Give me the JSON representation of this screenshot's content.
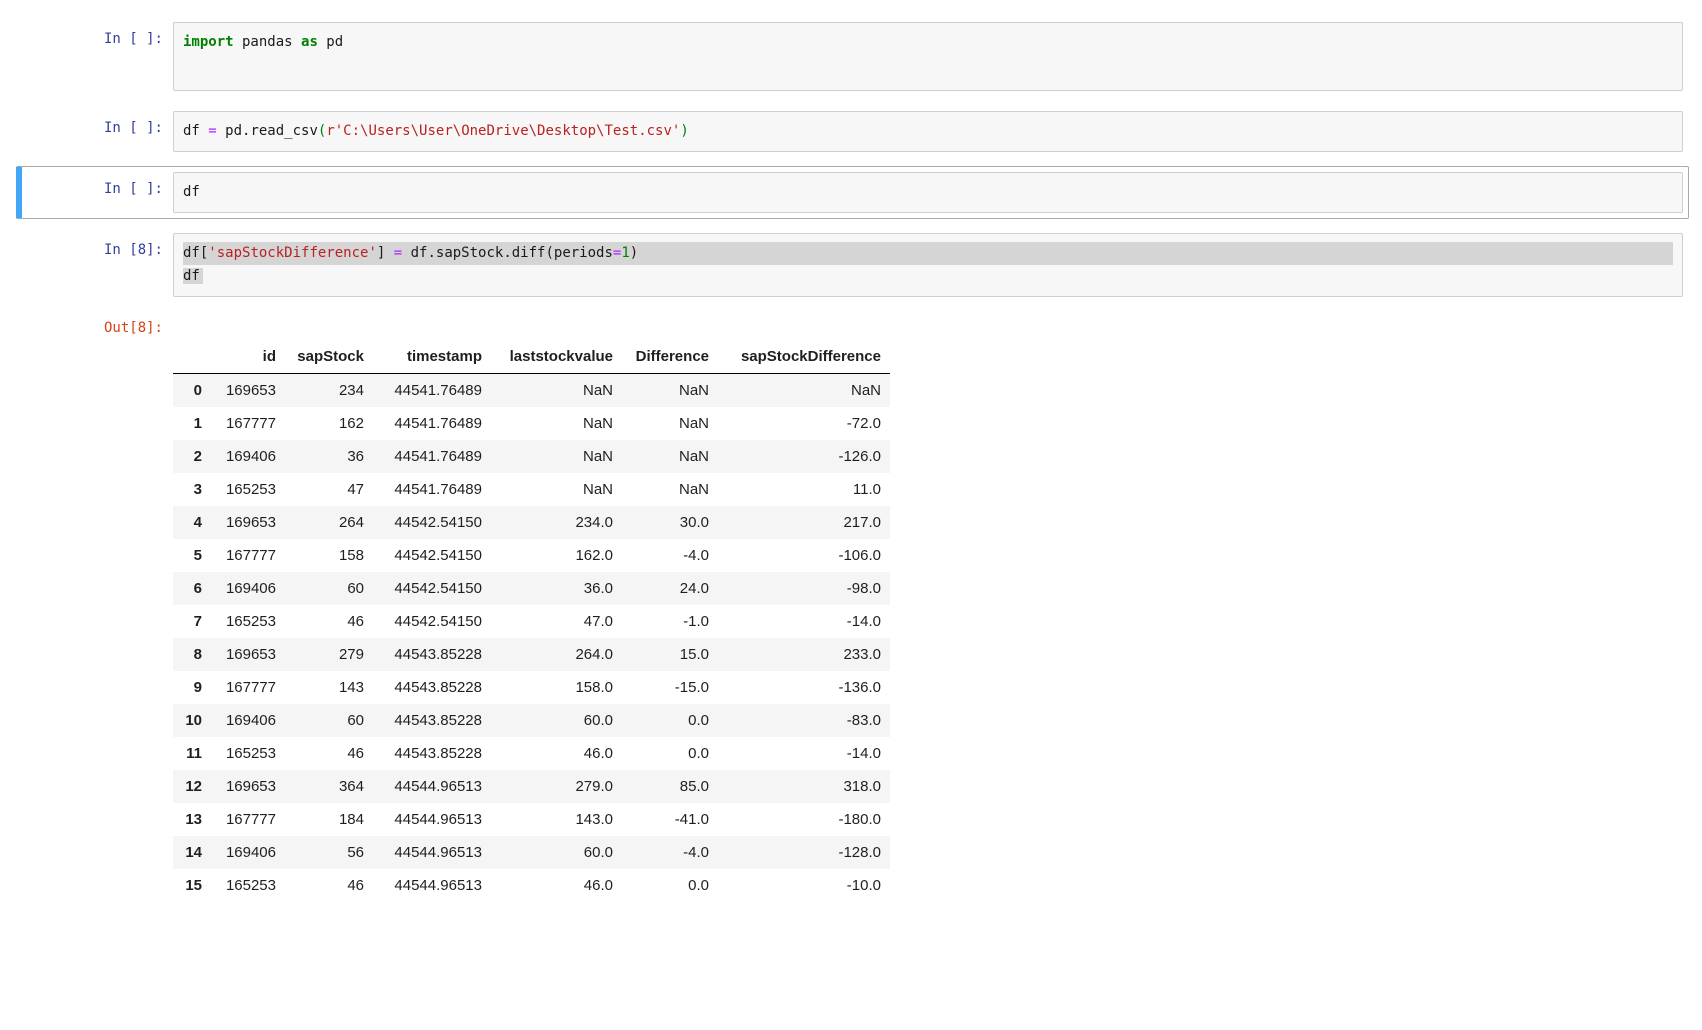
{
  "cells": [
    {
      "prompt": "In [ ]:",
      "selected": false,
      "lines": [
        {
          "sel": null,
          "tokens": [
            {
              "t": "import",
              "c": "kw"
            },
            {
              "t": " pandas ",
              "c": "plain"
            },
            {
              "t": "as",
              "c": "kw"
            },
            {
              "t": " pd",
              "c": "plain"
            }
          ]
        }
      ]
    },
    {
      "prompt": "In [ ]:",
      "selected": false,
      "lines": [
        {
          "sel": null,
          "tokens": [
            {
              "t": "df ",
              "c": "plain"
            },
            {
              "t": "=",
              "c": "op"
            },
            {
              "t": " pd.read_csv",
              "c": "plain"
            },
            {
              "t": "(",
              "c": "paren"
            },
            {
              "t": "r'C:\\Users\\User\\OneDrive\\Desktop\\Test.csv'",
              "c": "str"
            },
            {
              "t": ")",
              "c": "paren"
            }
          ]
        }
      ]
    },
    {
      "prompt": "In [ ]:",
      "selected": true,
      "lines": [
        {
          "sel": null,
          "tokens": [
            {
              "t": "df",
              "c": "plain"
            }
          ]
        }
      ]
    },
    {
      "prompt": "In [8]:",
      "selected": false,
      "lines": [
        {
          "sel": "full",
          "tokens": [
            {
              "t": "df[",
              "c": "plain"
            },
            {
              "t": "'sapStockDifference'",
              "c": "str"
            },
            {
              "t": "] ",
              "c": "plain"
            },
            {
              "t": "=",
              "c": "op"
            },
            {
              "t": " df.sapStock.diff(periods",
              "c": "plain"
            },
            {
              "t": "=",
              "c": "op"
            },
            {
              "t": "1",
              "c": "num"
            },
            {
              "t": ")",
              "c": "plain"
            }
          ]
        },
        {
          "sel": "inline",
          "tokens": [
            {
              "t": "df",
              "c": "plain"
            }
          ]
        }
      ]
    }
  ],
  "output": {
    "prompt": "Out[8]:",
    "table": {
      "columns": [
        "",
        "id",
        "sapStock",
        "timestamp",
        "laststockvalue",
        "Difference",
        "sapStockDifference"
      ],
      "rows": [
        [
          "0",
          "169653",
          "234",
          "44541.76489",
          "NaN",
          "NaN",
          "NaN"
        ],
        [
          "1",
          "167777",
          "162",
          "44541.76489",
          "NaN",
          "NaN",
          "-72.0"
        ],
        [
          "2",
          "169406",
          "36",
          "44541.76489",
          "NaN",
          "NaN",
          "-126.0"
        ],
        [
          "3",
          "165253",
          "47",
          "44541.76489",
          "NaN",
          "NaN",
          "11.0"
        ],
        [
          "4",
          "169653",
          "264",
          "44542.54150",
          "234.0",
          "30.0",
          "217.0"
        ],
        [
          "5",
          "167777",
          "158",
          "44542.54150",
          "162.0",
          "-4.0",
          "-106.0"
        ],
        [
          "6",
          "169406",
          "60",
          "44542.54150",
          "36.0",
          "24.0",
          "-98.0"
        ],
        [
          "7",
          "165253",
          "46",
          "44542.54150",
          "47.0",
          "-1.0",
          "-14.0"
        ],
        [
          "8",
          "169653",
          "279",
          "44543.85228",
          "264.0",
          "15.0",
          "233.0"
        ],
        [
          "9",
          "167777",
          "143",
          "44543.85228",
          "158.0",
          "-15.0",
          "-136.0"
        ],
        [
          "10",
          "169406",
          "60",
          "44543.85228",
          "60.0",
          "0.0",
          "-83.0"
        ],
        [
          "11",
          "165253",
          "46",
          "44543.85228",
          "46.0",
          "0.0",
          "-14.0"
        ],
        [
          "12",
          "169653",
          "364",
          "44544.96513",
          "279.0",
          "85.0",
          "318.0"
        ],
        [
          "13",
          "167777",
          "184",
          "44544.96513",
          "143.0",
          "-41.0",
          "-180.0"
        ],
        [
          "14",
          "169406",
          "56",
          "44544.96513",
          "60.0",
          "-4.0",
          "-128.0"
        ],
        [
          "15",
          "165253",
          "46",
          "44544.96513",
          "46.0",
          "0.0",
          "-10.0"
        ]
      ]
    }
  },
  "colors": {
    "selected_cell_bar": "#42A5F5",
    "selected_cell_border": "#ababab",
    "input_prompt": "#303F9F",
    "output_prompt": "#D84315",
    "keyword": "#008000",
    "string": "#BA2121",
    "operator": "#AA22FF",
    "cell_background": "#f7f7f7",
    "cell_border": "#cfcfcf",
    "text_selection": "#d5d5d5",
    "row_stripe": "#f5f5f5"
  }
}
